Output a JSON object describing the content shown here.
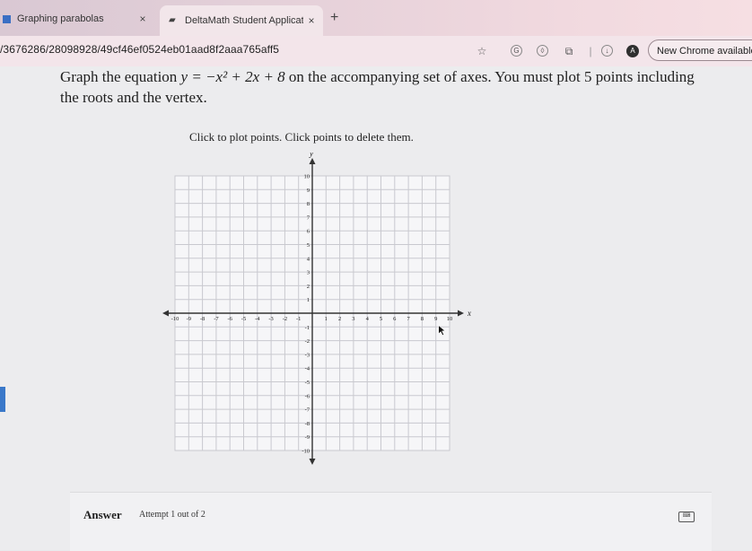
{
  "browser": {
    "tabs": [
      {
        "title": "Graphing parabolas",
        "close": "×"
      },
      {
        "title": "DeltaMath Student Applicatio",
        "close": "×"
      }
    ],
    "new_tab": "+",
    "url": "/3676286/28098928/49cf46ef0524eb01aad8f2aaa765aff5",
    "avatar_letter": "A",
    "update_label": "New Chrome available"
  },
  "question": {
    "text_before": "Graph the equation ",
    "equation": "y = −x² + 2x + 8",
    "text_after": " on the accompanying set of axes. You must plot 5 points including the roots and the vertex."
  },
  "instruction": "Click to plot points. Click points to delete them.",
  "graph": {
    "x_label": "x",
    "y_label": "y",
    "x_range": [
      -10,
      10
    ],
    "y_range": [
      -10,
      10
    ],
    "x_ticks": [
      "-10",
      "-9",
      "-8",
      "-7",
      "-6",
      "-5",
      "-4",
      "-3",
      "-2",
      "-1",
      "1",
      "2",
      "3",
      "4",
      "5",
      "6",
      "7",
      "8",
      "9",
      "10"
    ],
    "y_ticks": [
      "10",
      "9",
      "8",
      "7",
      "6",
      "5",
      "4",
      "3",
      "2",
      "1",
      "-1",
      "-2",
      "-3",
      "-4",
      "-5",
      "-6",
      "-7",
      "-8",
      "-9",
      "-10"
    ],
    "grid_color": "#c9c9cf",
    "axis_color": "#333333"
  },
  "answer": {
    "label": "Answer",
    "attempt": "Attempt 1 out of 2"
  },
  "colors": {
    "accent": "#3a78c9",
    "tab_bar": "#e7d2da"
  }
}
